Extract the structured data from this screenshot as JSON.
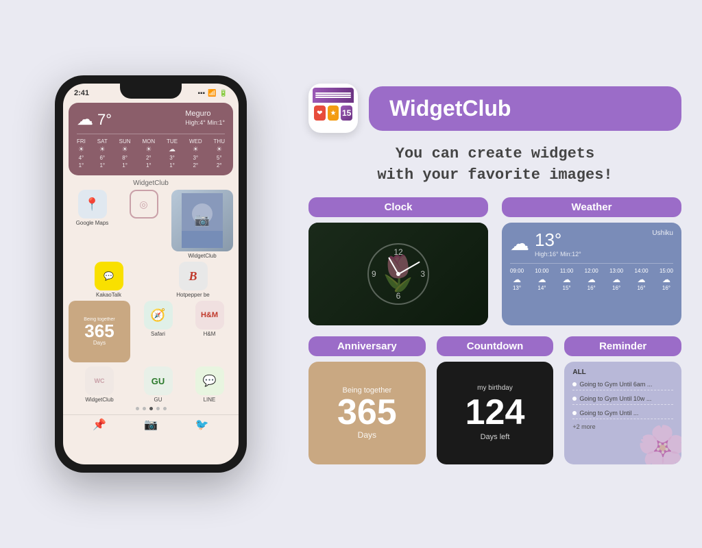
{
  "page": {
    "background": "#eaeaf2"
  },
  "phone": {
    "time": "2:41",
    "weather": {
      "temp": "7°",
      "high": "4°",
      "low": "1°",
      "location": "Meguro",
      "description": "Cloudy",
      "forecast": [
        {
          "day": "FRI",
          "icon": "☀",
          "high": "4",
          "low": "1"
        },
        {
          "day": "SAT",
          "icon": "☀",
          "high": "6",
          "low": "1"
        },
        {
          "day": "SUN",
          "icon": "☀",
          "high": "8",
          "low": "1"
        },
        {
          "day": "MON",
          "icon": "☀",
          "high": "2",
          "low": "1"
        },
        {
          "day": "TUE",
          "icon": "☁",
          "high": "3",
          "low": "1"
        },
        {
          "day": "WED",
          "icon": "☀",
          "high": "3",
          "low": "2"
        },
        {
          "day": "THU",
          "icon": "☀",
          "high": "5",
          "low": "2"
        }
      ]
    },
    "widget_club_label": "WidgetClub",
    "apps_row1": [
      {
        "label": "Google Maps",
        "icon": "📍"
      },
      {
        "label": "",
        "icon": "◎"
      },
      {
        "label": "",
        "icon": ""
      }
    ],
    "apps_row2": [
      {
        "label": "KakaoTalk",
        "icon": "💬"
      },
      {
        "label": "Hotpepper be",
        "icon": "B"
      },
      {
        "label": "WidgetClub",
        "icon": "W"
      }
    ],
    "anniversary": {
      "subtitle": "Being together",
      "number": "365",
      "unit": "Days"
    },
    "apps_row3": [
      {
        "label": "Safari",
        "icon": "🧭"
      },
      {
        "label": "H&M",
        "icon": "H&M"
      }
    ],
    "apps_row4": [
      {
        "label": "WidgetClub",
        "icon": "W"
      },
      {
        "label": "GU",
        "icon": "GU"
      },
      {
        "label": "LINE",
        "icon": "💬"
      }
    ],
    "bottom_apps": [
      "📌",
      "📷",
      "🐦"
    ]
  },
  "brand": {
    "name": "WidgetClub",
    "tagline_line1": "You can create widgets",
    "tagline_line2": "with your favorite images!"
  },
  "widgets": {
    "clock": {
      "badge": "Clock",
      "time_display": "12"
    },
    "weather": {
      "badge": "Weather",
      "temp": "13°",
      "location": "Ushiku",
      "high": "16°",
      "low": "12°",
      "times": [
        "09:00",
        "10:00",
        "11:00",
        "12:00",
        "13:00",
        "14:00",
        "15:00"
      ],
      "temps": [
        "13°",
        "14°",
        "15°",
        "16°",
        "16°",
        "16°",
        "16°"
      ]
    },
    "anniversary": {
      "badge": "Anniversary",
      "subtitle": "Being together",
      "number": "365",
      "unit": "Days"
    },
    "countdown": {
      "badge": "Countdown",
      "title": "my birthday",
      "number": "124",
      "unit": "Days left"
    },
    "reminder": {
      "badge": "Reminder",
      "label": "ALL",
      "items": [
        "Going to Gym Until 6am ...",
        "Going to Gym Until 10w ...",
        ""
      ],
      "more": "+2 more"
    }
  }
}
